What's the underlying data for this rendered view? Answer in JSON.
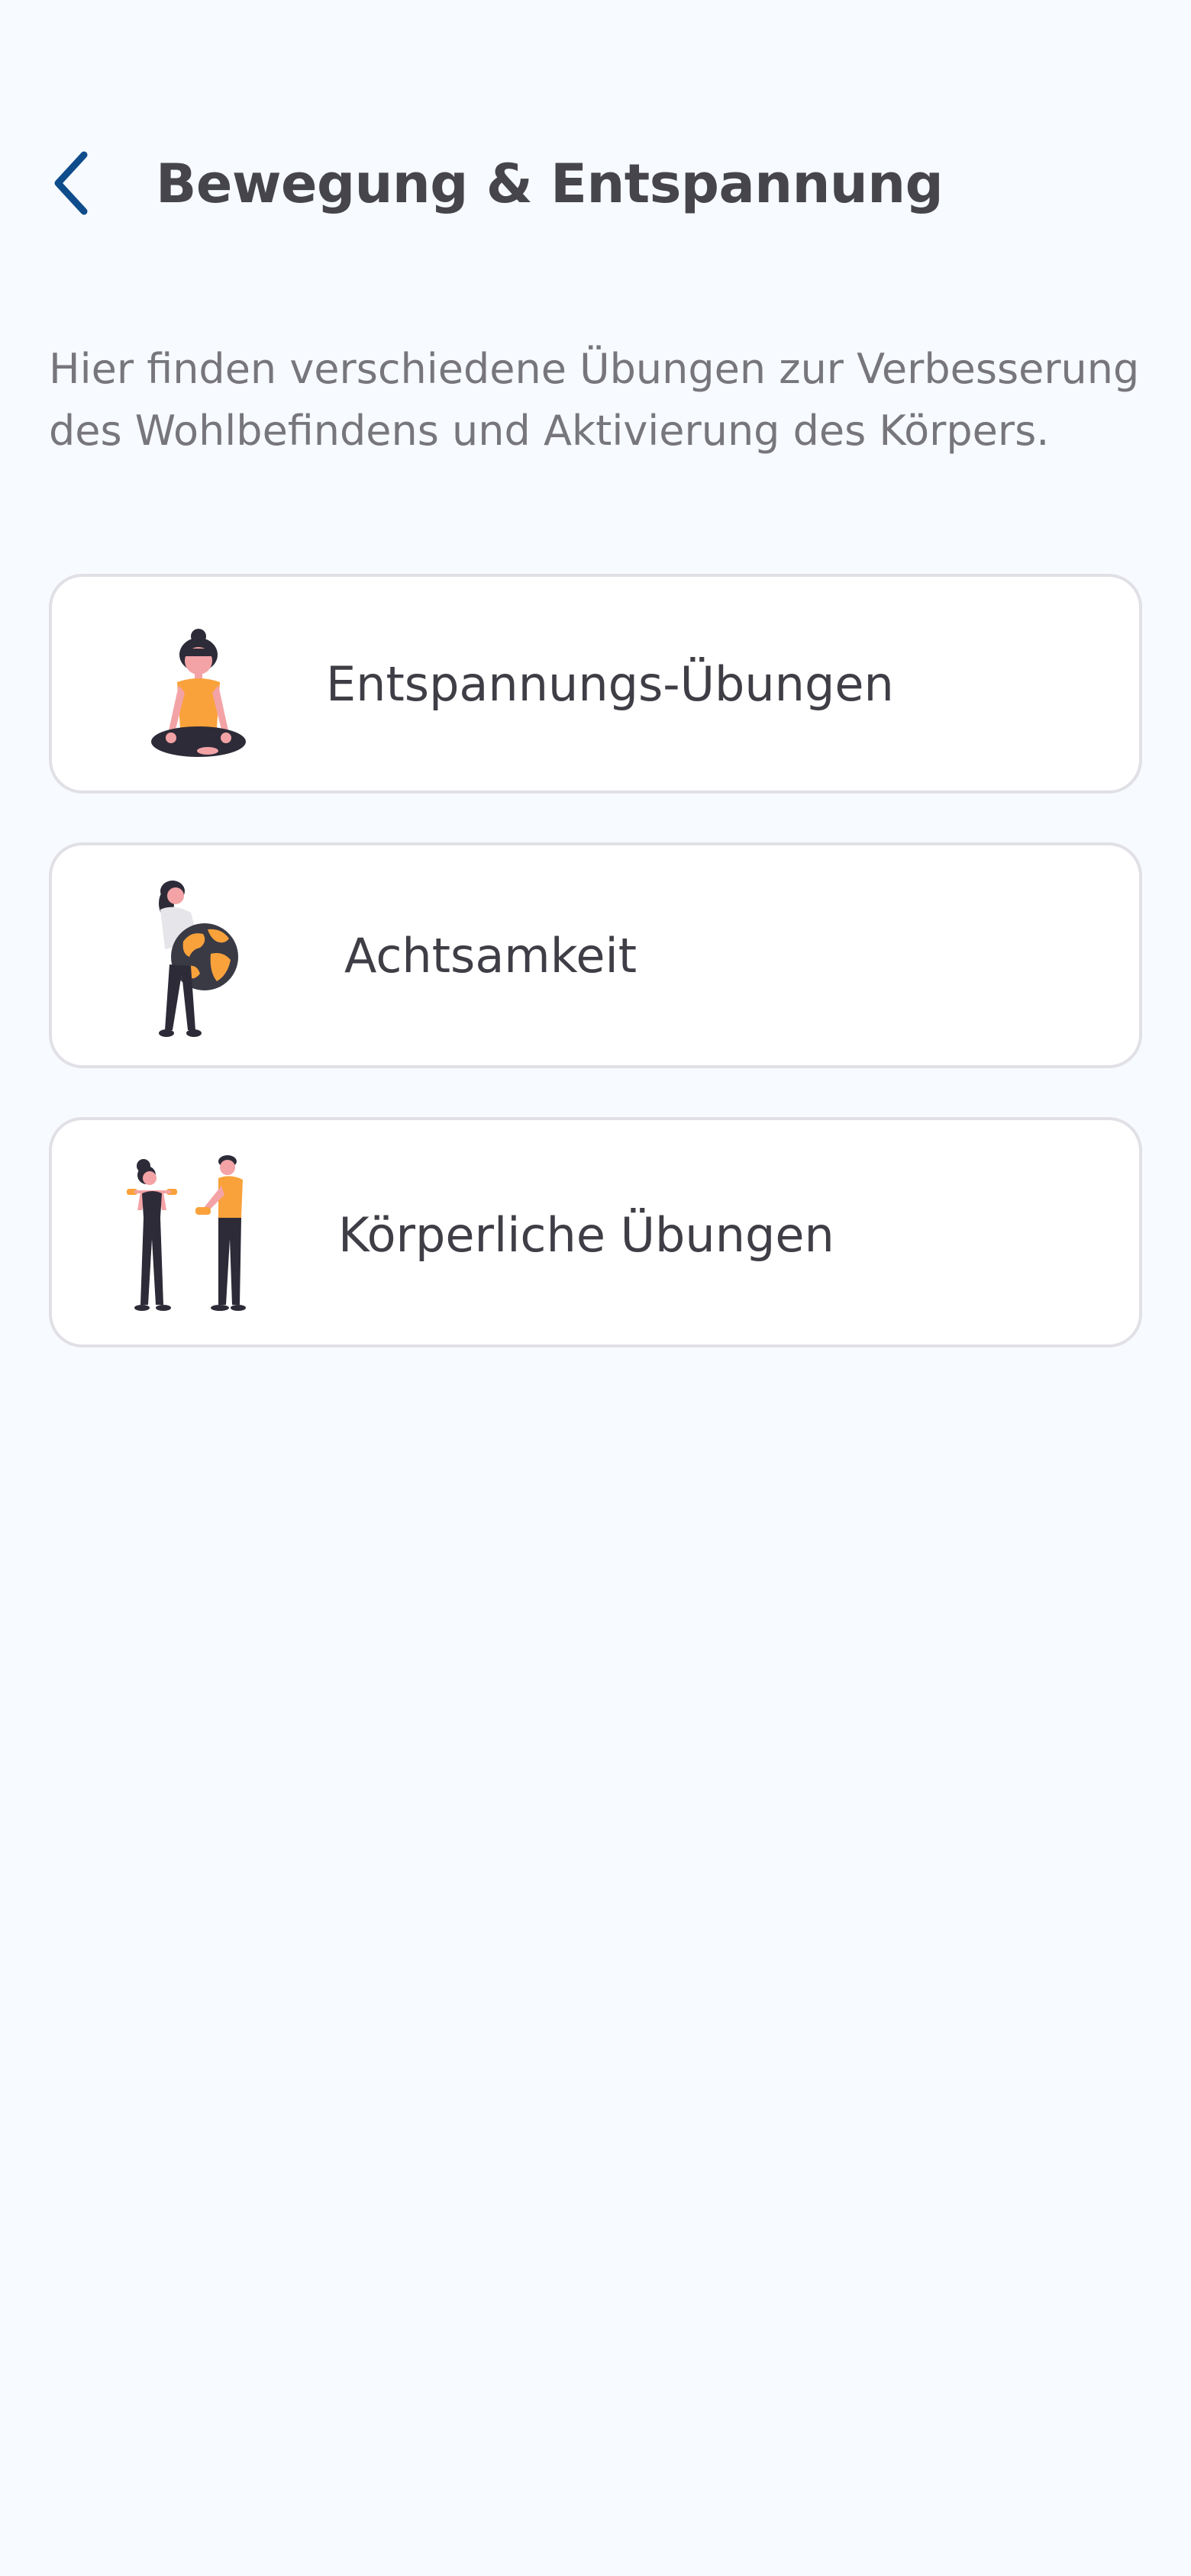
{
  "header": {
    "title": "Bewegung & Entspannung",
    "back_icon": "chevron-left-icon",
    "accent_color": "#0f4c8b"
  },
  "intro": {
    "text": "Hier finden verschiedene Übungen zur Verbesserung des Wohlbefindens und Aktivierung des Körpers."
  },
  "cards": [
    {
      "label": "Entspannungs-Übungen",
      "illustration": "meditation-illustration"
    },
    {
      "label": "Achtsamkeit",
      "illustration": "globe-illustration"
    },
    {
      "label": "Körperliche Übungen",
      "illustration": "exercise-illustration"
    }
  ],
  "colors": {
    "background": "#f7fafe",
    "card_border": "#e1e0e6",
    "illustration_orange": "#f9a23b",
    "illustration_dark": "#2e2b38"
  }
}
